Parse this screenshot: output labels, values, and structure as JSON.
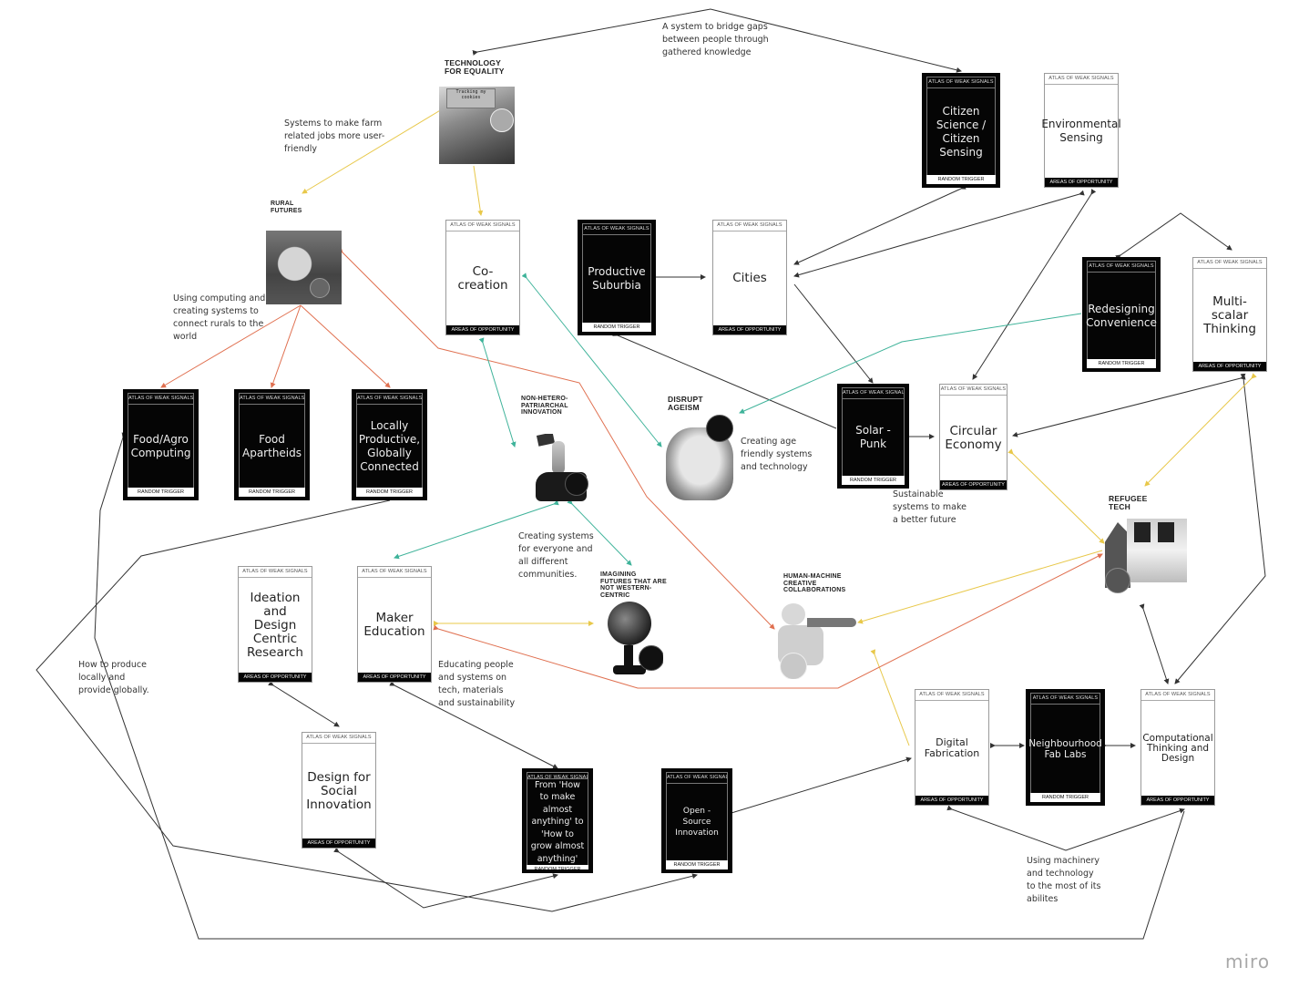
{
  "app": {
    "watermark": "miro"
  },
  "colors": {
    "black_link": "#333333",
    "yellow_link": "#e8c84a",
    "red_link": "#e07050",
    "teal_link": "#3fb39a"
  },
  "card_header": "ATLAS OF WEAK SIGNALS",
  "footer_random": "RANDOM TRIGGER",
  "footer_areas": "AREAS OF OPPORTUNITY",
  "cards": {
    "citizen_science": {
      "title": "Citizen Science / Citizen Sensing",
      "type": "random-trigger"
    },
    "environmental_sensing": {
      "title": "Environmental Sensing",
      "type": "areas-of-opportunity"
    },
    "co_creation": {
      "title": "Co-creation",
      "type": "areas-of-opportunity"
    },
    "productive_suburbia": {
      "title": "Productive Suburbia",
      "type": "random-trigger"
    },
    "cities": {
      "title": "Cities",
      "type": "areas-of-opportunity"
    },
    "redesigning_convenience": {
      "title": "Redesigning Convenience",
      "type": "random-trigger"
    },
    "multi_scalar": {
      "title": "Multi-scalar Thinking",
      "type": "areas-of-opportunity"
    },
    "food_agro": {
      "title": "Food/Agro Computing",
      "type": "random-trigger"
    },
    "food_apartheids": {
      "title": "Food Apartheids",
      "type": "random-trigger"
    },
    "locally_productive": {
      "title": "Locally Productive, Globally Connected",
      "type": "random-trigger"
    },
    "solar_punk": {
      "title": "Solar - Punk",
      "type": "random-trigger"
    },
    "circular_economy": {
      "title": "Circular Economy",
      "type": "areas-of-opportunity"
    },
    "ideation": {
      "title": "Ideation and Design Centric Research",
      "type": "areas-of-opportunity"
    },
    "maker_education": {
      "title": "Maker Education",
      "type": "areas-of-opportunity"
    },
    "design_social": {
      "title": "Design for Social Innovation",
      "type": "areas-of-opportunity"
    },
    "how_to_make": {
      "title": "From 'How to make almost anything' to 'How to grow almost anything'",
      "type": "random-trigger"
    },
    "open_source": {
      "title": "Open - Source Innovation",
      "type": "random-trigger"
    },
    "digital_fabrication": {
      "title": "Digital Fabrication",
      "type": "areas-of-opportunity"
    },
    "neighbourhood_fab": {
      "title": "Neighbourhood Fab Labs",
      "type": "random-trigger"
    },
    "computational": {
      "title": "Computational Thinking and Design",
      "type": "areas-of-opportunity"
    }
  },
  "signals": {
    "technology_equality": {
      "label": "TECHNOLOGY FOR EQUALITY",
      "image_caption": "Tracking my cookies"
    },
    "rural_futures": {
      "label": "RURAL FUTURES"
    },
    "non_hetero": {
      "label": "NON-HETERO-PATRIARCHAL INNOVATION"
    },
    "disrupt_ageism": {
      "label": "DISRUPT AGEISM"
    },
    "refugee_tech": {
      "label": "REFUGEE TECH"
    },
    "imagining_futures": {
      "label": "IMAGINING FUTURES THAT ARE NOT WESTERN-CENTRIC"
    },
    "human_machine": {
      "label": "HUMAN-MACHINE CREATIVE COLLABORATIONS"
    }
  },
  "notes": {
    "bridge_gaps": "A system to bridge gaps between people through gathered knowledge",
    "farm_jobs": "Systems to make farm related jobs more user-friendly",
    "rural_connect": "Using computing and creating systems to connect rurals to the world",
    "age_friendly": "Creating age friendly systems and technology",
    "sustainable": "Sustainable systems to make a better future",
    "everyone": "Creating systems for everyone and all different communities.",
    "educating": "Educating people and systems on tech, materials and sustainability",
    "produce_locally": "How to produce locally and provide globally.",
    "machinery": "Using machinery and technology to the most of its abilites"
  }
}
